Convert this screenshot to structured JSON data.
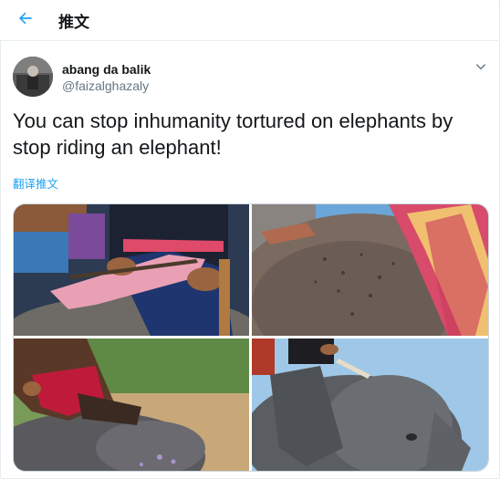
{
  "header": {
    "title": "推文",
    "back_icon": "arrow-left-icon"
  },
  "tweet": {
    "display_name": "abang da balik",
    "handle": "@faizalghazaly",
    "text": "You can stop inhumanity tortured on elephants by stop riding an elephant!",
    "translate_label": "翻译推文"
  },
  "media": {
    "count": 4,
    "photos": [
      "mahout-riding-elephant-photo",
      "elephant-skin-wounds-photo",
      "rider-on-elephant-back-photo",
      "elephant-with-hook-photo"
    ]
  },
  "colors": {
    "accent": "#1da1f2",
    "text": "#14171a",
    "secondary": "#657786",
    "border": "#e6ecf0"
  }
}
